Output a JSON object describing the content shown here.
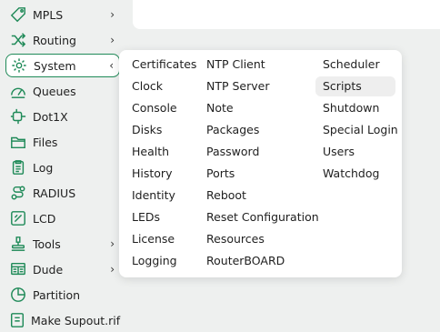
{
  "sidebar": {
    "items": [
      {
        "label": "MPLS",
        "icon": "tag-icon",
        "arrow": "›"
      },
      {
        "label": "Routing",
        "icon": "shuffle-icon",
        "arrow": "›"
      },
      {
        "label": "System",
        "icon": "gear-icon",
        "arrow": "‹"
      },
      {
        "label": "Queues",
        "icon": "gauge-icon"
      },
      {
        "label": "Dot1X",
        "icon": "plug-icon"
      },
      {
        "label": "Files",
        "icon": "folder-icon"
      },
      {
        "label": "Log",
        "icon": "clipboard-icon"
      },
      {
        "label": "RADIUS",
        "icon": "route-icon"
      },
      {
        "label": "LCD",
        "icon": "lcd-icon"
      },
      {
        "label": "Tools",
        "icon": "tools-icon",
        "arrow": "›"
      },
      {
        "label": "Dude",
        "icon": "dude-icon",
        "arrow": "›"
      },
      {
        "label": "Partition",
        "icon": "partition-icon"
      },
      {
        "label": "Make Supout.rif",
        "icon": "supout-icon"
      }
    ]
  },
  "system_submenu": {
    "columns": [
      [
        "Certificates",
        "Clock",
        "Console",
        "Disks",
        "Health",
        "History",
        "Identity",
        "LEDs",
        "License",
        "Logging"
      ],
      [
        "NTP Client",
        "NTP Server",
        "Note",
        "Packages",
        "Password",
        "Ports",
        "Reboot",
        "Reset Configuration",
        "Resources",
        "RouterBOARD"
      ],
      [
        "Scheduler",
        "Scripts",
        "Shutdown",
        "Special Login",
        "Users",
        "Watchdog"
      ]
    ],
    "highlighted": "Scripts"
  },
  "colors": {
    "accent": "#1f8a58",
    "background": "#eef0ef",
    "panel": "#ffffff",
    "hover": "#eeeeee"
  }
}
